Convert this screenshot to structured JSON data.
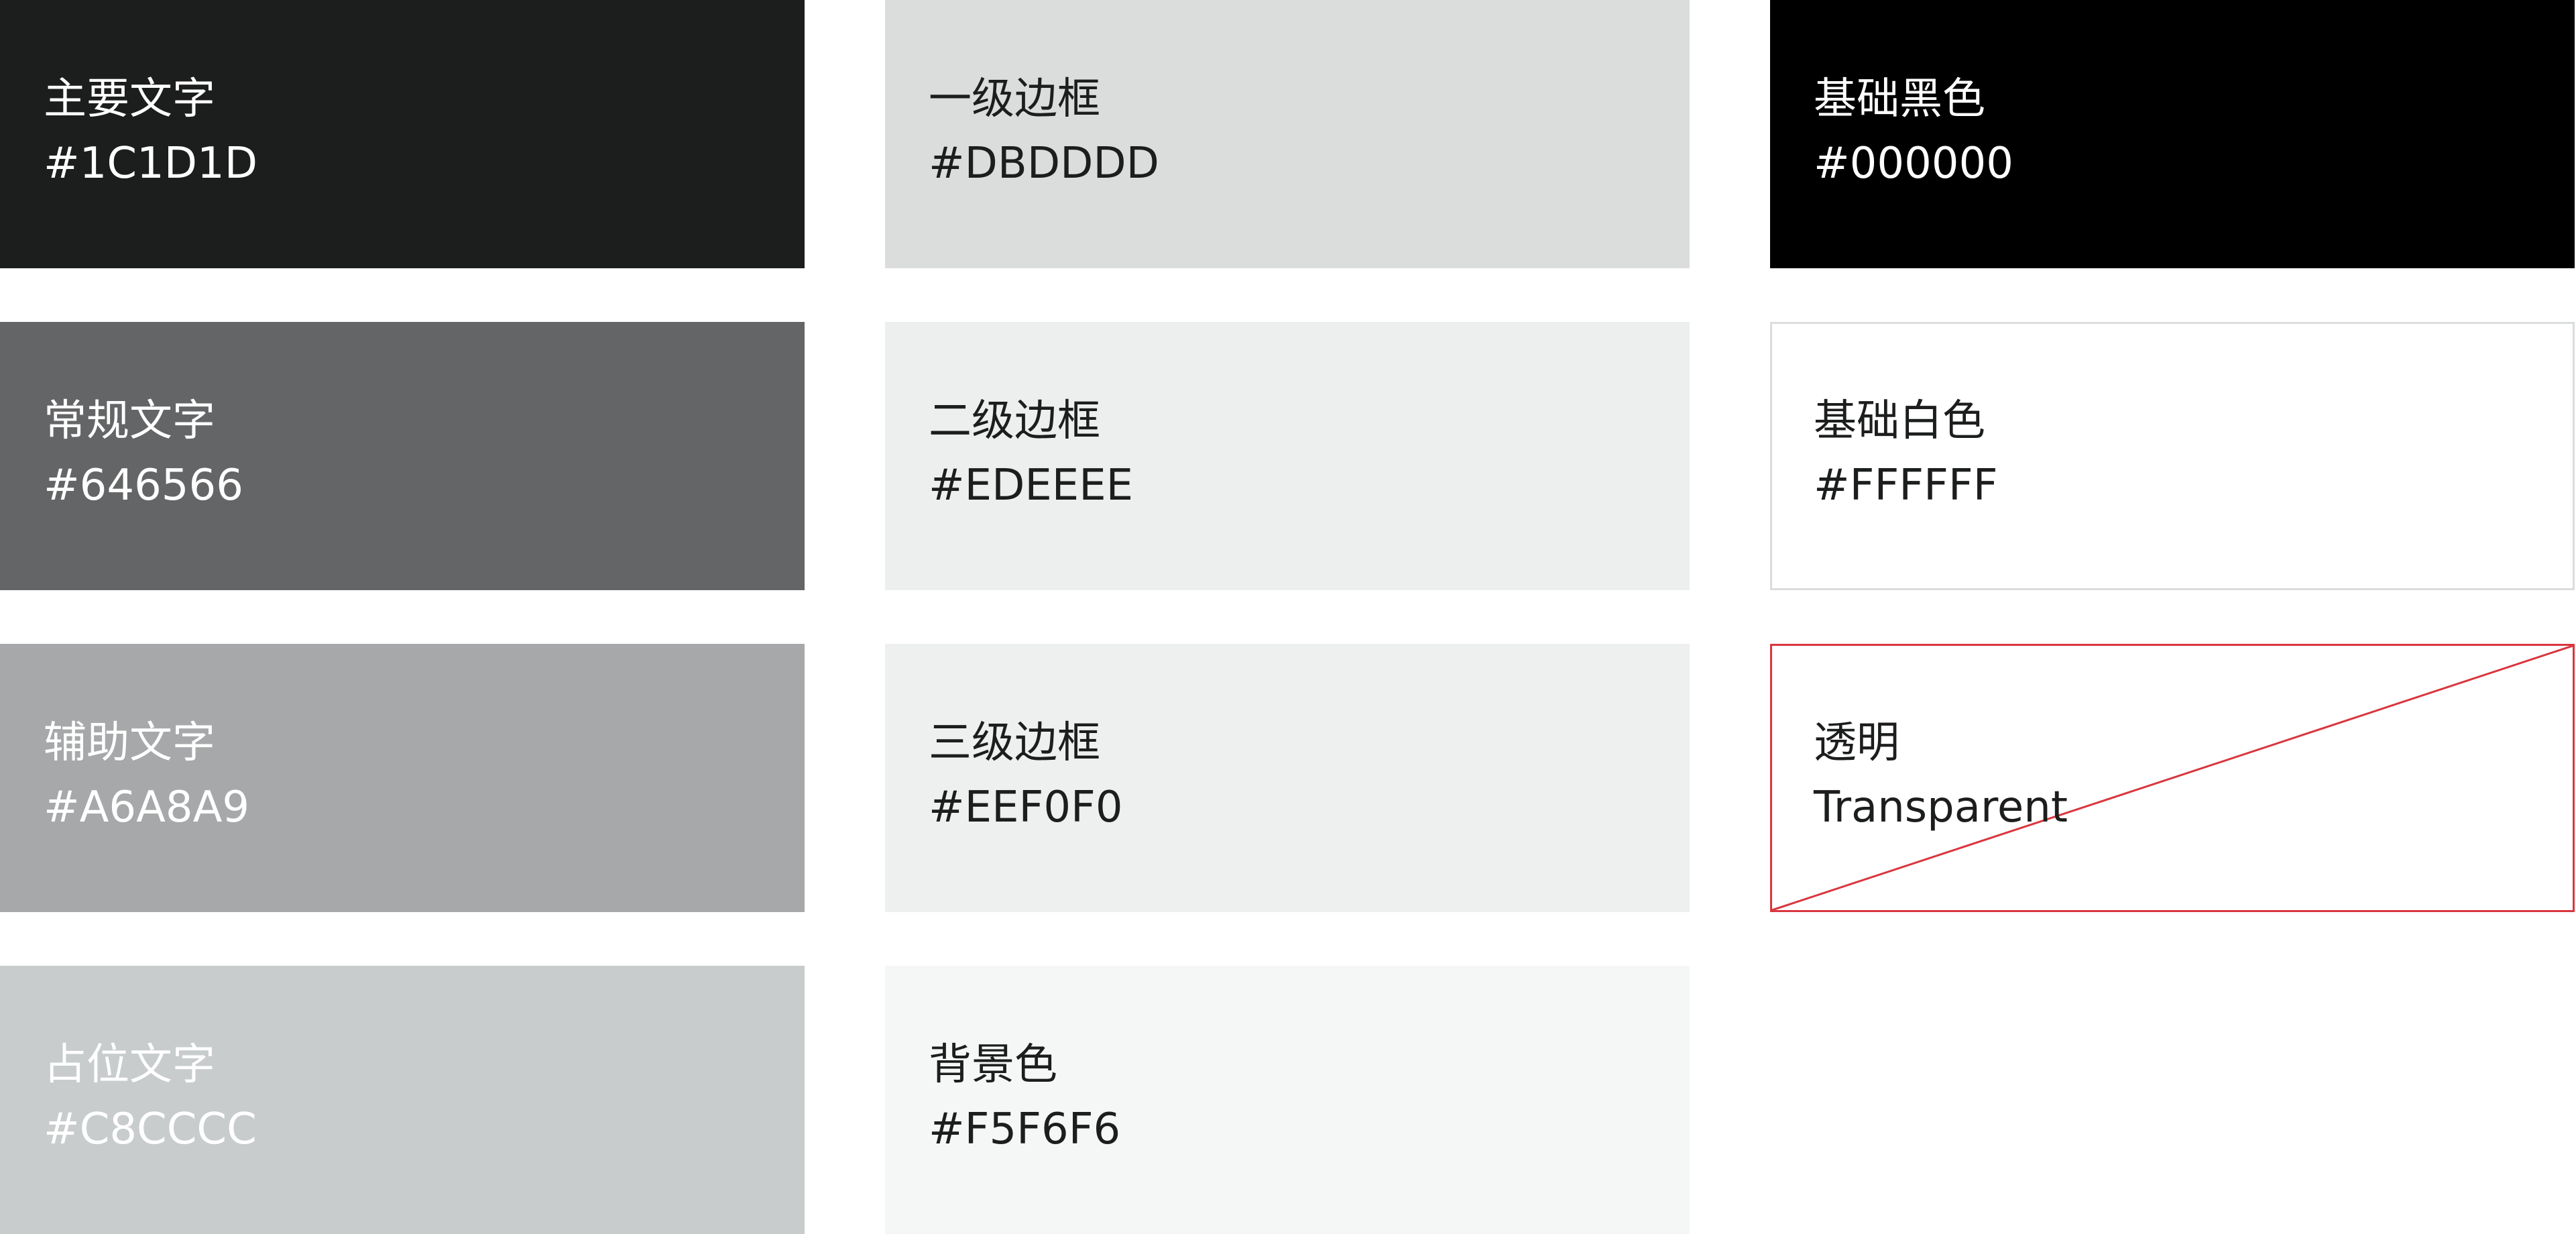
{
  "swatches": [
    {
      "id": "primary-text",
      "name": "主要文字",
      "code": "#1C1D1D",
      "color": "#1C1D1D",
      "text_color": "#FFFFFF"
    },
    {
      "id": "regular-text",
      "name": "常规文字",
      "code": "#646566",
      "color": "#646566",
      "text_color": "#FFFFFF"
    },
    {
      "id": "secondary-text",
      "name": "辅助文字",
      "code": "#A6A8A9",
      "color": "#A6A8A9",
      "text_color": "#FFFFFF"
    },
    {
      "id": "placeholder-text",
      "name": "占位文字",
      "code": "#C8CCCC",
      "color": "#C8CCCC",
      "text_color": "#FFFFFF"
    },
    {
      "id": "border-level-1",
      "name": "一级边框",
      "code": "#DBDDDD",
      "color": "#DBDDDD",
      "text_color": "#1C1D1D"
    },
    {
      "id": "border-level-2",
      "name": "二级边框",
      "code": "#EDEEEE",
      "color": "#EDEEEE",
      "text_color": "#1C1D1D"
    },
    {
      "id": "border-level-3",
      "name": "三级边框",
      "code": "#EEF0F0",
      "color": "#EEF0F0",
      "text_color": "#1C1D1D"
    },
    {
      "id": "background",
      "name": "背景色",
      "code": "#F5F6F6",
      "color": "#F5F6F6",
      "text_color": "#1C1D1D"
    },
    {
      "id": "base-black",
      "name": "基础黑色",
      "code": "#000000",
      "color": "#000000",
      "text_color": "#FFFFFF"
    },
    {
      "id": "base-white",
      "name": "基础白色",
      "code": "#FFFFFF",
      "color": "#FFFFFF",
      "text_color": "#1C1D1D",
      "border_color": "#DBDDDD"
    },
    {
      "id": "transparent",
      "name": "透明",
      "code": "Transparent",
      "color": "transparent",
      "text_color": "#1C1D1D",
      "border_color": "#D9363E"
    }
  ]
}
